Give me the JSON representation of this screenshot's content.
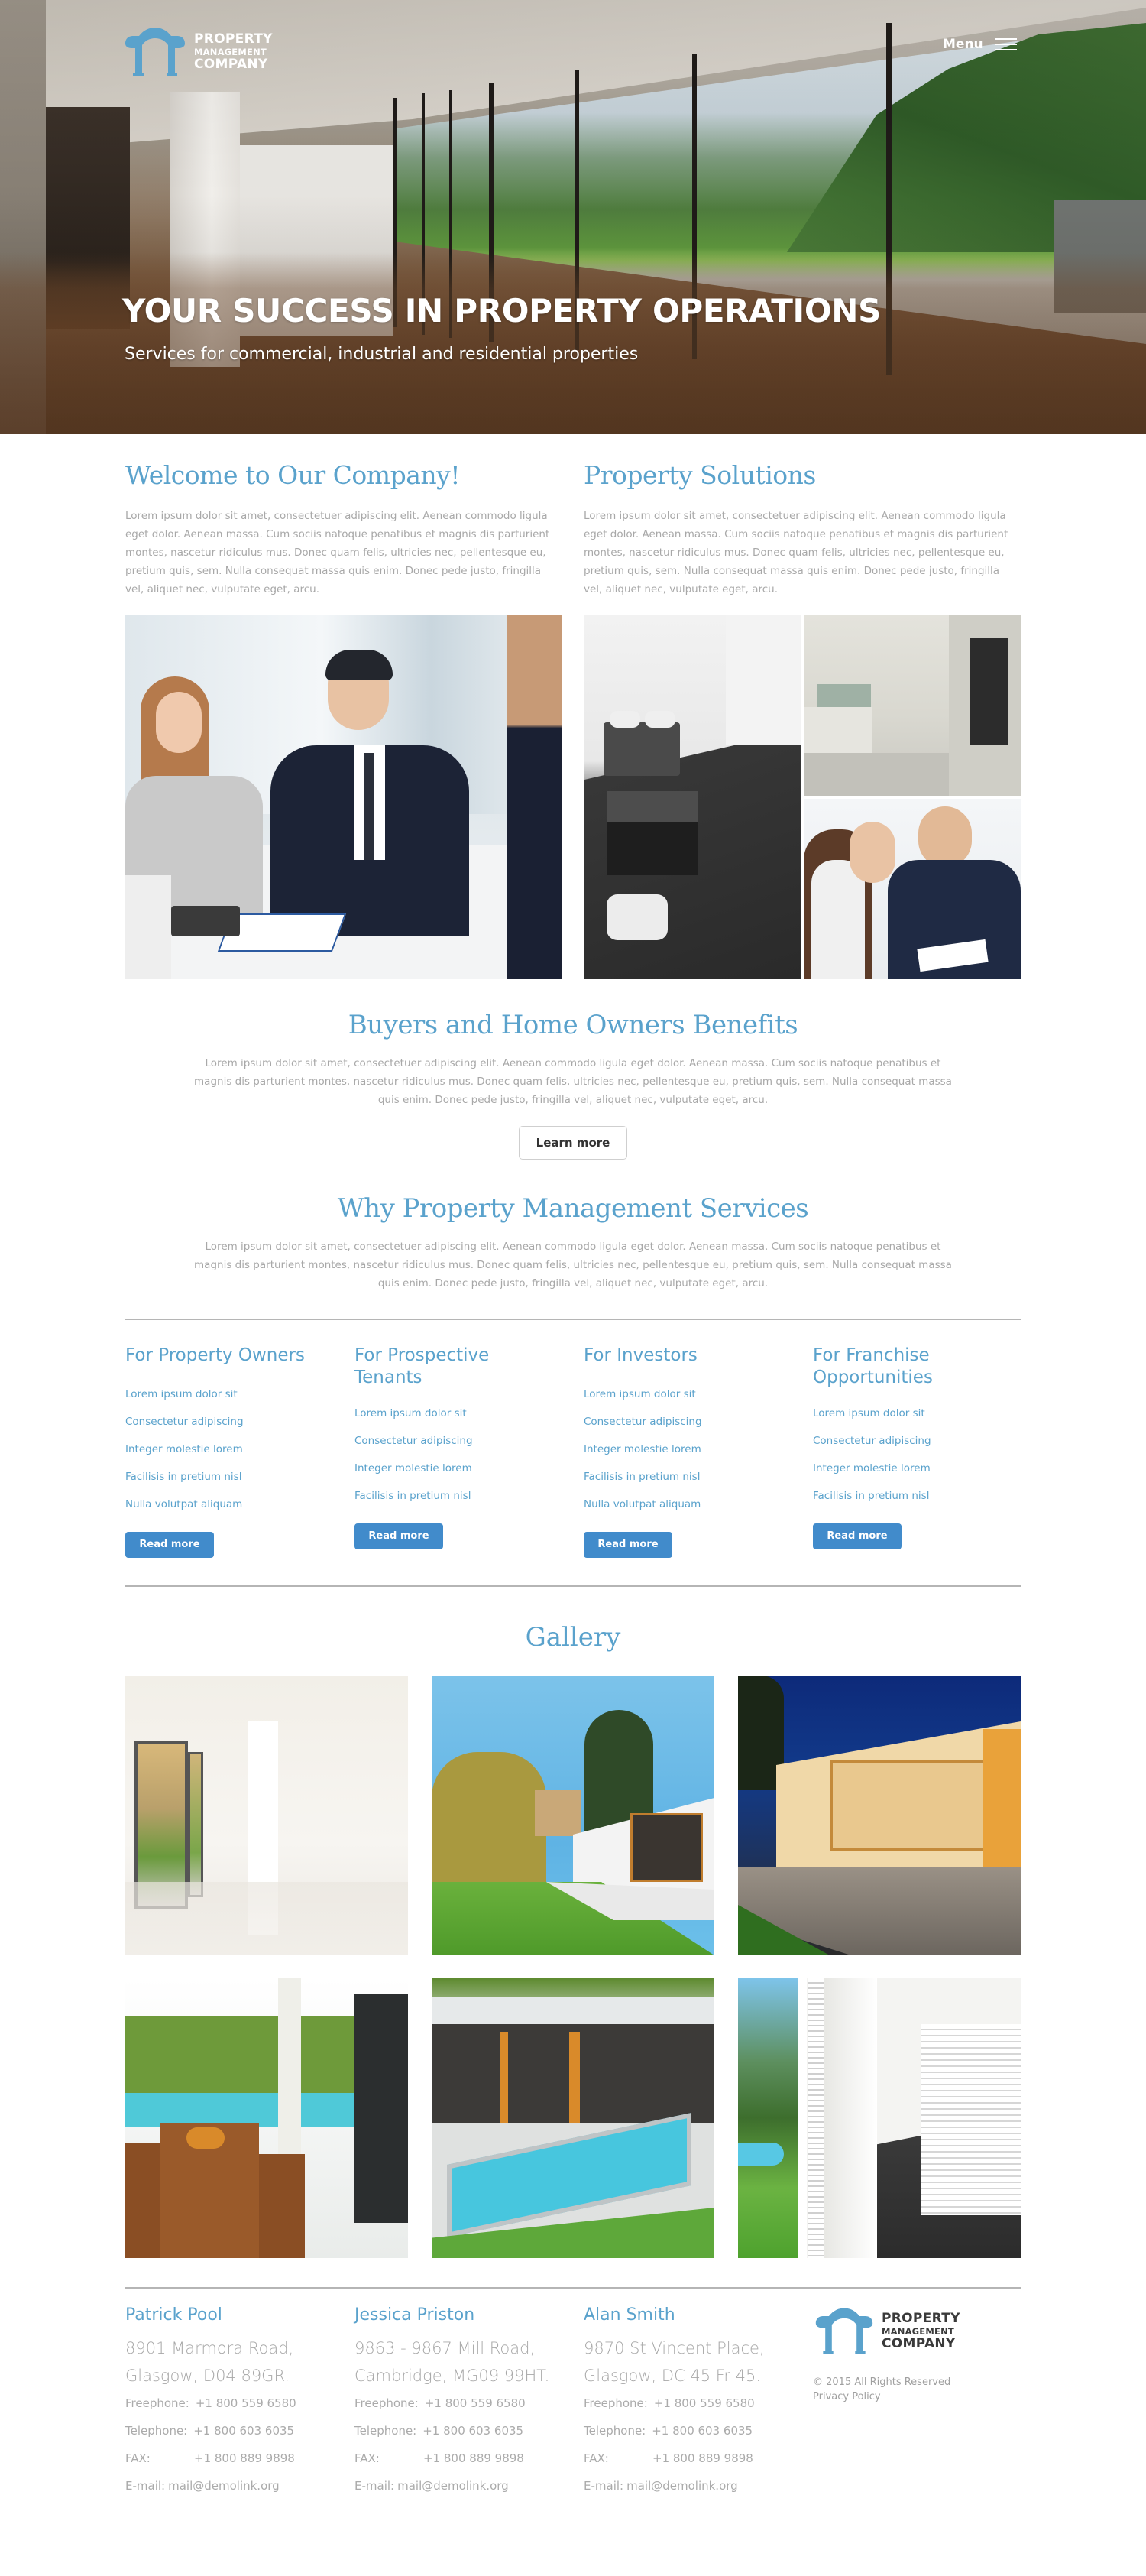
{
  "brand": {
    "line1": "PROPERTY",
    "line2": "MANAGEMENT",
    "line3": "COMPANY",
    "accent_color": "#5aa2cc",
    "logo_icon": "arch-icon"
  },
  "header": {
    "menu_label": "Menu",
    "menu_icon": "hamburger-icon"
  },
  "hero": {
    "title": "YOUR SUCCESS IN PROPERTY OPERATIONS",
    "subtitle": "Services for commercial, industrial and residential properties"
  },
  "intro": {
    "welcome": {
      "title": "Welcome to Our Company!",
      "body": "Lorem ipsum dolor sit amet, consectetuer adipiscing elit. Aenean commodo ligula eget dolor. Aenean massa. Cum sociis natoque penatibus et magnis dis parturient montes, nascetur ridiculus mus. Donec quam felis, ultricies nec, pellentesque eu, pretium quis, sem. Nulla consequat massa quis enim. Donec pede justo, fringilla vel, aliquet nec, vulputate eget, arcu."
    },
    "solutions": {
      "title": "Property Solutions",
      "body": "Lorem ipsum dolor sit amet, consectetuer adipiscing elit. Aenean commodo ligula eget dolor. Aenean massa. Cum sociis natoque penatibus et magnis dis parturient montes, nascetur ridiculus mus. Donec quam felis, ultricies nec, pellentesque eu, pretium quis, sem. Nulla consequat massa quis enim. Donec pede justo, fringilla vel, aliquet nec, vulputate eget, arcu."
    }
  },
  "buyers": {
    "title": "Buyers and Home Owners Benefits",
    "body": "Lorem ipsum dolor sit amet, consectetuer adipiscing elit. Aenean commodo ligula eget dolor. Aenean massa. Cum sociis natoque penatibus et magnis dis parturient montes, nascetur ridiculus mus. Donec quam felis, ultricies nec, pellentesque eu, pretium quis, sem. Nulla consequat massa quis enim. Donec pede justo, fringilla vel, aliquet nec, vulputate eget, arcu.",
    "button_label": "Learn more"
  },
  "why": {
    "title": "Why Property Management Services",
    "body": "Lorem ipsum dolor sit amet, consectetuer adipiscing elit. Aenean commodo ligula eget dolor. Aenean massa. Cum sociis natoque penatibus et magnis dis parturient montes, nascetur ridiculus mus. Donec quam felis, ultricies nec, pellentesque eu, pretium quis, sem. Nulla consequat massa quis enim. Donec pede justo, fringilla vel, aliquet nec, vulputate eget, arcu."
  },
  "services": [
    {
      "title": "For Property Owners",
      "items": [
        "Lorem ipsum dolor sit",
        "Consectetur adipiscing",
        "Integer molestie lorem",
        "Facilisis in pretium nisl",
        "Nulla volutpat aliquam"
      ],
      "button_label": "Read more"
    },
    {
      "title": "For Prospective Tenants",
      "items": [
        "Lorem ipsum dolor sit",
        "Consectetur adipiscing",
        "Integer molestie lorem",
        "Facilisis in pretium nisl"
      ],
      "button_label": "Read more"
    },
    {
      "title": "For Investors",
      "items": [
        "Lorem ipsum dolor sit",
        "Consectetur adipiscing",
        "Integer molestie lorem",
        "Facilisis in pretium nisl",
        "Nulla volutpat aliquam"
      ],
      "button_label": "Read more"
    },
    {
      "title": "For Franchise Opportunities",
      "items": [
        "Lorem ipsum dolor sit",
        "Consectetur adipiscing",
        "Integer molestie lorem",
        "Facilisis in pretium nisl"
      ],
      "button_label": "Read more"
    }
  ],
  "gallery": {
    "title": "Gallery",
    "images": [
      "empty-interior-with-glass-wall",
      "modern-house-with-lawn",
      "house-terrace-at-night",
      "patio-dining-table-by-pool",
      "villa-with-swimming-pool",
      "glass-corridor-with-mountain-view"
    ]
  },
  "contacts": [
    {
      "name": "Patrick Pool",
      "address_line1": "8901 Marmora Road,",
      "address_line2": "Glasgow, D04 89GR.",
      "freephone_label": "Freephone:",
      "freephone": "+1 800 559 6580",
      "telephone_label": "Telephone:",
      "telephone": "+1 800 603 6035",
      "fax_label": "FAX:",
      "fax": "+1 800 889 9898",
      "email_label": "E-mail:",
      "email": "mail@demolink.org"
    },
    {
      "name": "Jessica Priston",
      "address_line1": "9863 - 9867 Mill Road,",
      "address_line2": "Cambridge, MG09 99HT.",
      "freephone_label": "Freephone:",
      "freephone": "+1 800 559 6580",
      "telephone_label": "Telephone:",
      "telephone": "+1 800 603 6035",
      "fax_label": "FAX:",
      "fax": "+1 800 889 9898",
      "email_label": "E-mail:",
      "email": "mail@demolink.org"
    },
    {
      "name": "Alan Smith",
      "address_line1": "9870 St Vincent Place,",
      "address_line2": "Glasgow, DC 45 Fr 45.",
      "freephone_label": "Freephone:",
      "freephone": "+1 800 559 6580",
      "telephone_label": "Telephone:",
      "telephone": "+1 800 603 6035",
      "fax_label": "FAX:",
      "fax": "+1 800 889 9898",
      "email_label": "E-mail:",
      "email": "mail@demolink.org"
    }
  ],
  "footer": {
    "copyright": "© 2015 All Rights Reserved",
    "privacy_label": "Privacy Policy"
  }
}
